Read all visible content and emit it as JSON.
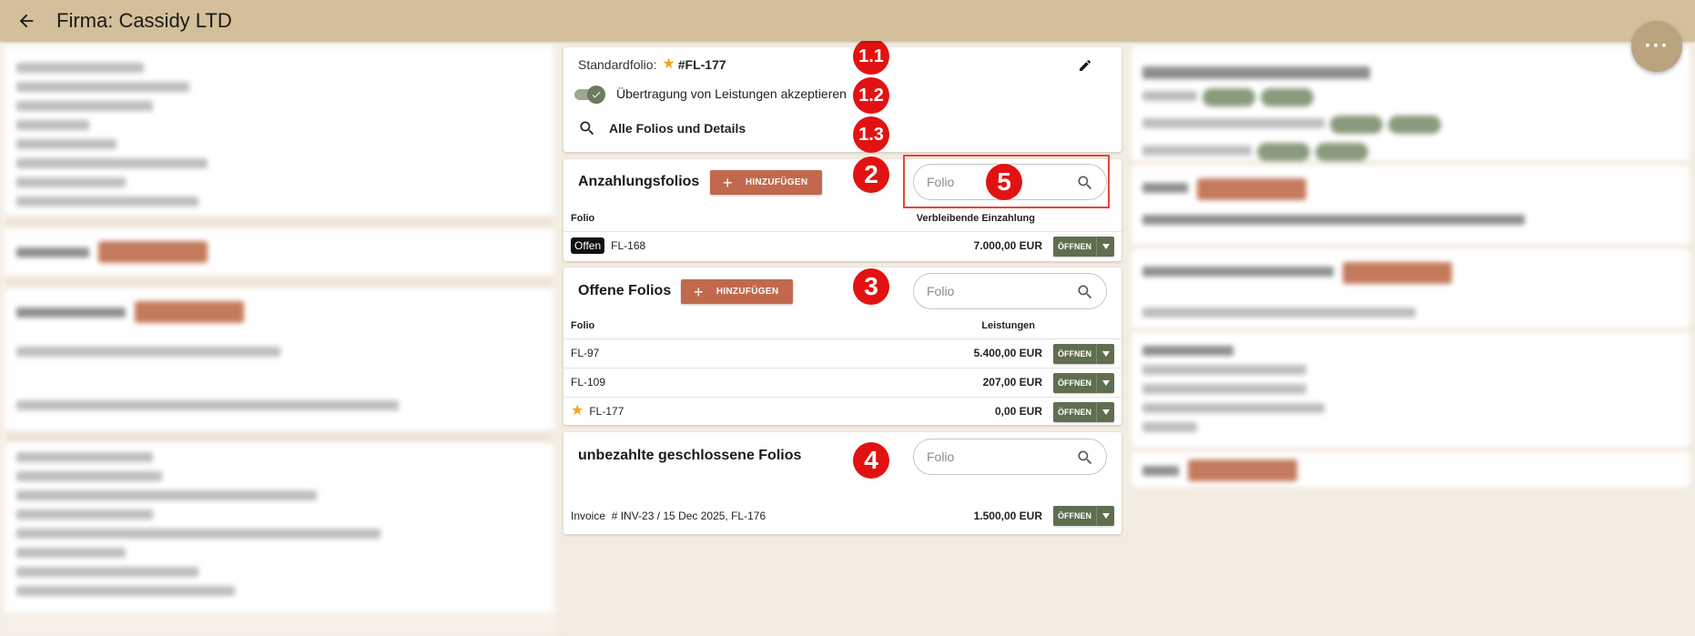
{
  "header": {
    "title": "Firma: Cassidy LTD"
  },
  "fab": {
    "label": "···"
  },
  "settings": {
    "standard_label": "Standardfolio:",
    "standard_value": "#FL-177",
    "transfer_label": "Übertragung von Leistungen akzeptieren",
    "transfer_enabled": true,
    "all_folios_label": "Alle Folios und Details"
  },
  "deposit_folios": {
    "title": "Anzahlungsfolios",
    "add_label": "HINZUFÜGEN",
    "search_placeholder": "Folio",
    "col_folio": "Folio",
    "col_amount": "Verbleibende Einzahlung",
    "rows": [
      {
        "badge": "Offen",
        "folio": "FL-168",
        "amount": "7.000,00 EUR",
        "action": "ÖFFNEN"
      }
    ]
  },
  "open_folios": {
    "title": "Offene Folios",
    "add_label": "HINZUFÜGEN",
    "search_placeholder": "Folio",
    "col_folio": "Folio",
    "col_amount": "Leistungen",
    "rows": [
      {
        "folio": "FL-97",
        "amount": "5.400,00 EUR",
        "action": "ÖFFNEN",
        "starred": false
      },
      {
        "folio": "FL-109",
        "amount": "207,00 EUR",
        "action": "ÖFFNEN",
        "starred": false
      },
      {
        "folio": "FL-177",
        "amount": "0,00 EUR",
        "action": "ÖFFNEN",
        "starred": true
      }
    ]
  },
  "unpaid_closed": {
    "title": "unbezahlte geschlossene Folios",
    "search_placeholder": "Folio",
    "rows": [
      {
        "folio": "Invoice  # INV-23 / 15 Dec 2025, FL-176",
        "amount": "1.500,00 EUR",
        "action": "ÖFFNEN"
      }
    ]
  },
  "markers": [
    "1.1",
    "1.2",
    "1.3",
    "2",
    "3",
    "4",
    "5"
  ],
  "colors": {
    "header_bg": "#d3bf99",
    "add_button": "#c2694d",
    "open_button": "#5f6e4f",
    "marker": "#e21212",
    "star": "#f3a31b"
  }
}
